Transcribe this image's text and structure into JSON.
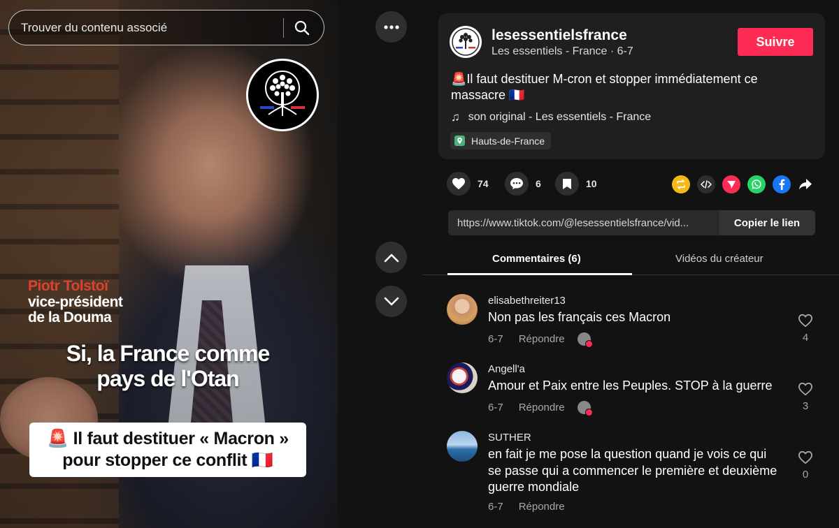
{
  "search": {
    "placeholder": "Trouver du contenu associé",
    "icon": "search-icon"
  },
  "video": {
    "caption_name": "Piotr Tolstoï",
    "caption_role_1": "vice-président",
    "caption_role_2": "de la Douma",
    "subtitle_1": "Si, la France comme",
    "subtitle_2": "pays de l'Otan",
    "banner_1": "🚨 Il faut destituer « Macron »",
    "banner_2": "pour stopper ce conflit 🇫🇷",
    "name_color": "#d9432f"
  },
  "nav": {
    "more_icon": "more-icon",
    "up_icon": "chevron-up-icon",
    "down_icon": "chevron-down-icon"
  },
  "author": {
    "username": "lesessentielsfrance",
    "info": "Les essentiels - France · 6-7",
    "follow_label": "Suivre",
    "follow_color": "#fe2c55",
    "description": "🚨Il faut destituer M-cron et stopper immédiatement ce massacre 🇫🇷",
    "music": "son original - Les essentiels - France",
    "location": "Hauts-de-France"
  },
  "stats": {
    "likes": "74",
    "comments": "6",
    "saves": "10"
  },
  "share": [
    "repost-icon",
    "embed-icon",
    "send-icon",
    "whatsapp-icon",
    "facebook-icon",
    "share-icon"
  ],
  "link": {
    "url": "https://www.tiktok.com/@lesessentielsfrance/vid...",
    "copy_label": "Copier le lien"
  },
  "tabs": {
    "comments": "Commentaires (6)",
    "creator": "Vidéos du créateur"
  },
  "comments": [
    {
      "user": "elisabethreiter13",
      "text": "Non pas les français ces Macron",
      "date": "6-7",
      "reply": "Répondre",
      "likes": "4"
    },
    {
      "user": "Angell'a",
      "text": "Amour et Paix entre les Peuples. STOP à la guerre",
      "date": "6-7",
      "reply": "Répondre",
      "likes": "3"
    },
    {
      "user": "SUTHER",
      "text": "en fait je me pose la question quand je vois ce qui se passe qui a commencer le première et deuxième guerre mondiale",
      "date": "6-7",
      "reply": "Répondre",
      "likes": "0"
    }
  ]
}
